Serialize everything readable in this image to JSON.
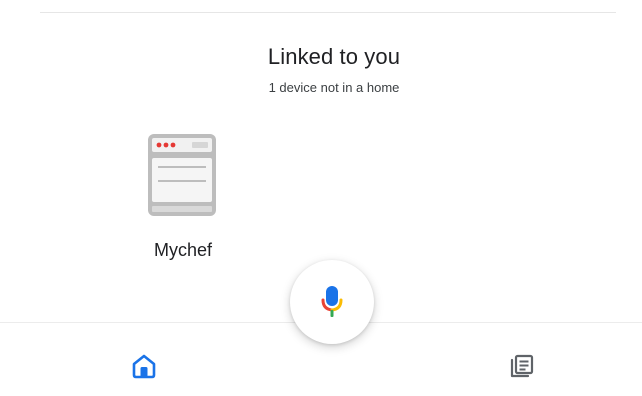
{
  "section": {
    "title": "Linked to you",
    "subtitle": "1 device not in a home"
  },
  "devices": [
    {
      "label": "Mychef",
      "icon": "oven-icon"
    }
  ],
  "fab": {
    "icon": "microphone-icon"
  },
  "bottom_nav": [
    {
      "icon": "home-icon",
      "active": true
    },
    {
      "icon": "feed-icon",
      "active": false
    }
  ],
  "colors": {
    "accent_blue": "#1a73e8",
    "mic_red": "#ea4335",
    "mic_yellow": "#fbbc04",
    "mic_green": "#34a853",
    "device_gray": "#bdbdbd",
    "indicator_red": "#e53935"
  }
}
